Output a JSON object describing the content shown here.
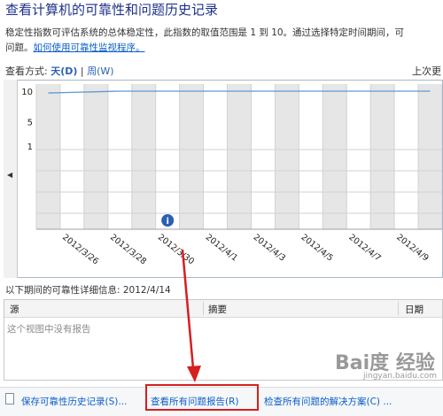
{
  "header": {
    "title": "查看计算机的可靠性和问题历史记录",
    "description": "稳定性指数可评估系统的总体稳定性，此指数的取值范围是 1 到 10。通过选择特定时间期间，可",
    "description_line2": "问题。",
    "help_link": "如何使用可靠性监视程序。"
  },
  "view_by": {
    "label": "查看方式:",
    "day": "天(D)",
    "separator": "|",
    "week": "周(W)",
    "prev_link": "上次更"
  },
  "chart_data": {
    "type": "line",
    "y_ticks": [
      "10",
      "5",
      "1"
    ],
    "ylim": [
      1,
      10
    ],
    "x_tick_labels": [
      "2012/3/26",
      "2012/3/28",
      "2012/3/30",
      "2012/4/1",
      "2012/4/3",
      "2012/4/5",
      "2012/4/7",
      "2012/4/9"
    ],
    "series": [
      {
        "values": [
          9.7,
          9.8,
          9.9,
          10,
          10,
          10,
          10,
          10,
          10,
          10,
          10,
          10,
          10,
          10,
          10,
          10,
          10
        ]
      }
    ],
    "info_event_index": 5,
    "colors": {
      "line": "#5a9bd5",
      "shade": "#e6e6e6",
      "grid": "#d2d2d2",
      "info": "#2b5fb4"
    }
  },
  "details": {
    "label": "以下期间的可靠性详细信息: 2012/4/14",
    "columns": [
      "源",
      "摘要",
      "日期"
    ],
    "empty_message": "这个视图中没有报告"
  },
  "footer": {
    "save_history": "保存可靠性历史记录(S)...",
    "view_all_reports": "查看所有问题报告(R)",
    "check_solutions": "检查所有问题的解决方案(C) ..."
  },
  "watermark": {
    "text": "Bai度 经验",
    "sub": "jingyan.baidu.com"
  },
  "colors": {
    "annotation_red": "#d61f1f",
    "link": "#0a5ec8"
  }
}
